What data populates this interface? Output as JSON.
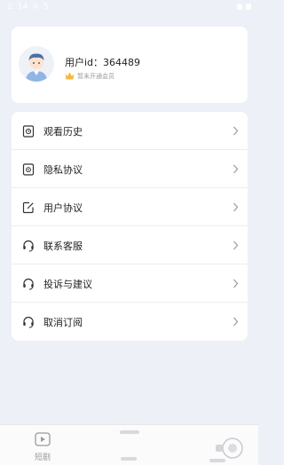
{
  "status_bar": {
    "time": "2:34 ① 5"
  },
  "profile": {
    "user_id_label": "用户id：364489",
    "vip_status": "暂未开通会员"
  },
  "menu": {
    "items": [
      {
        "label": "观看历史",
        "icon": "history-icon"
      },
      {
        "label": "隐私协议",
        "icon": "privacy-icon"
      },
      {
        "label": "用户协议",
        "icon": "agreement-icon"
      },
      {
        "label": "联系客服",
        "icon": "headset-icon"
      },
      {
        "label": "投诉与建议",
        "icon": "headset-icon"
      },
      {
        "label": "取消订阅",
        "icon": "headset-icon"
      }
    ]
  },
  "tab_bar": {
    "tabs": [
      {
        "label": "短剧",
        "icon": "video-icon"
      }
    ]
  },
  "colors": {
    "background": "#eef0f7",
    "card": "#ffffff",
    "crown": "#f4b942",
    "avatar_accent": "#8fb6e6"
  },
  "watermark": {
    "icon": "pc6-logo-icon"
  }
}
